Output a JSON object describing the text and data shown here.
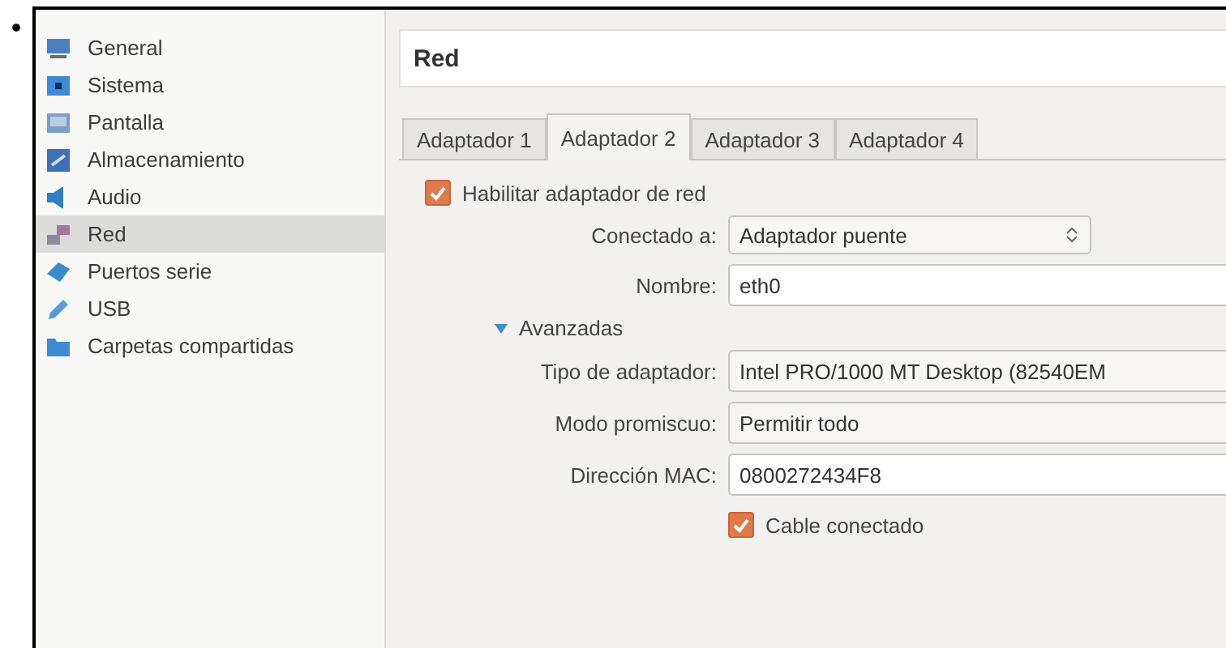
{
  "bullet": "•",
  "sidebar": {
    "items": [
      {
        "label": "General",
        "selected": false
      },
      {
        "label": "Sistema",
        "selected": false
      },
      {
        "label": "Pantalla",
        "selected": false
      },
      {
        "label": "Almacenamiento",
        "selected": false
      },
      {
        "label": "Audio",
        "selected": false
      },
      {
        "label": "Red",
        "selected": true
      },
      {
        "label": "Puertos serie",
        "selected": false
      },
      {
        "label": "USB",
        "selected": false
      },
      {
        "label": "Carpetas compartidas",
        "selected": false
      }
    ]
  },
  "header": {
    "title": "Red"
  },
  "tabs": [
    {
      "label": "Adaptador 1",
      "selected": false
    },
    {
      "label": "Adaptador 2",
      "selected": true
    },
    {
      "label": "Adaptador 3",
      "selected": false
    },
    {
      "label": "Adaptador 4",
      "selected": false
    }
  ],
  "enable": {
    "label": "Habilitar adaptador de red",
    "checked": true
  },
  "form": [
    {
      "kind": "select",
      "label": "Conectado a:",
      "value": "Adaptador puente"
    },
    {
      "kind": "input",
      "label": "Nombre:",
      "value": "eth0"
    },
    {
      "kind": "disclosure",
      "label": "Avanzadas",
      "expanded": true
    },
    {
      "kind": "wide-select",
      "label": "Tipo de adaptador:",
      "value": "Intel PRO/1000 MT Desktop (82540EM"
    },
    {
      "kind": "wide-select",
      "label": "Modo promiscuo:",
      "value": "Permitir todo"
    },
    {
      "kind": "input",
      "label": "Dirección MAC:",
      "value": "0800272434F8"
    },
    {
      "kind": "checkbox",
      "label": "Cable conectado",
      "checked": true
    }
  ]
}
